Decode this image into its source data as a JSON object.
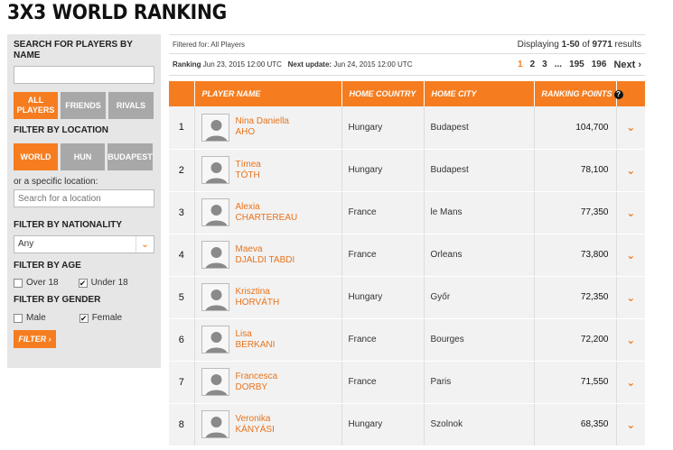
{
  "page_title": "3X3 WORLD RANKING",
  "sidebar": {
    "search_heading": "SEARCH FOR PLAYERS BY NAME",
    "search_value": "",
    "type_buttons": [
      {
        "label": "ALL PLAYERS",
        "active": true
      },
      {
        "label": "FRIENDS",
        "active": false
      },
      {
        "label": "RIVALS",
        "active": false
      }
    ],
    "location_heading": "FILTER BY LOCATION",
    "location_buttons": [
      {
        "label": "WORLD",
        "active": true
      },
      {
        "label": "HUN",
        "active": false
      },
      {
        "label": "BUDAPEST",
        "active": false
      }
    ],
    "specific_location_text": "or a specific location:",
    "location_placeholder": "Search for a location",
    "nationality_heading": "FILTER BY NATIONALITY",
    "nationality_selected": "Any",
    "age_heading": "FILTER BY AGE",
    "age_options": [
      {
        "label": "Over 18",
        "checked": false
      },
      {
        "label": "Under 18",
        "checked": true
      }
    ],
    "gender_heading": "FILTER BY GENDER",
    "gender_options": [
      {
        "label": "Male",
        "checked": false
      },
      {
        "label": "Female",
        "checked": true
      }
    ],
    "filter_button": "FILTER ›"
  },
  "results": {
    "filtered_for": "Filtered for: All Players",
    "displaying_prefix": "Displaying ",
    "displaying_range": "1-50",
    "displaying_of": " of ",
    "displaying_total": "9771",
    "displaying_suffix": " results",
    "ranking_label": "Ranking",
    "ranking_date": " Jun 23, 2015 12:00 UTC",
    "next_update_label": "Next update:",
    "next_update_date": " Jun 24, 2015 12:00 UTC"
  },
  "pager": {
    "pages": [
      "1",
      "2",
      "3"
    ],
    "ellipsis": "...",
    "last_pages": [
      "195",
      "196"
    ],
    "next": "Next ›"
  },
  "table": {
    "columns": [
      "PLAYER NAME",
      "HOME COUNTRY",
      "HOME CITY",
      "RANKING POINTS"
    ],
    "rows": [
      {
        "rank": "1",
        "first": "Nina Daniella",
        "last": "AHO",
        "country": "Hungary",
        "city": "Budapest",
        "points": "104,700"
      },
      {
        "rank": "2",
        "first": "Tímea",
        "last": "TÓTH",
        "country": "Hungary",
        "city": "Budapest",
        "points": "78,100"
      },
      {
        "rank": "3",
        "first": "Alexia",
        "last": "CHARTEREAU",
        "country": "France",
        "city": "le Mans",
        "points": "77,350"
      },
      {
        "rank": "4",
        "first": "Maeva",
        "last": "DJALDI TABDI",
        "country": "France",
        "city": "Orleans",
        "points": "73,800"
      },
      {
        "rank": "5",
        "first": "Krisztina",
        "last": "HORVÁTH",
        "country": "Hungary",
        "city": "Győr",
        "points": "72,350"
      },
      {
        "rank": "6",
        "first": "Lisa",
        "last": "BERKANI",
        "country": "France",
        "city": "Bourges",
        "points": "72,200"
      },
      {
        "rank": "7",
        "first": "Francesca",
        "last": "DORBY",
        "country": "France",
        "city": "Paris",
        "points": "71,550"
      },
      {
        "rank": "8",
        "first": "Veronika",
        "last": "KÁNYÁSI",
        "country": "Hungary",
        "city": "Szolnok",
        "points": "68,350"
      }
    ]
  },
  "colors": {
    "accent": "#f57d20",
    "inactive_button": "#a8a8a8",
    "sidebar_bg": "#e6e6e6",
    "row_bg": "#f2f2f2"
  }
}
